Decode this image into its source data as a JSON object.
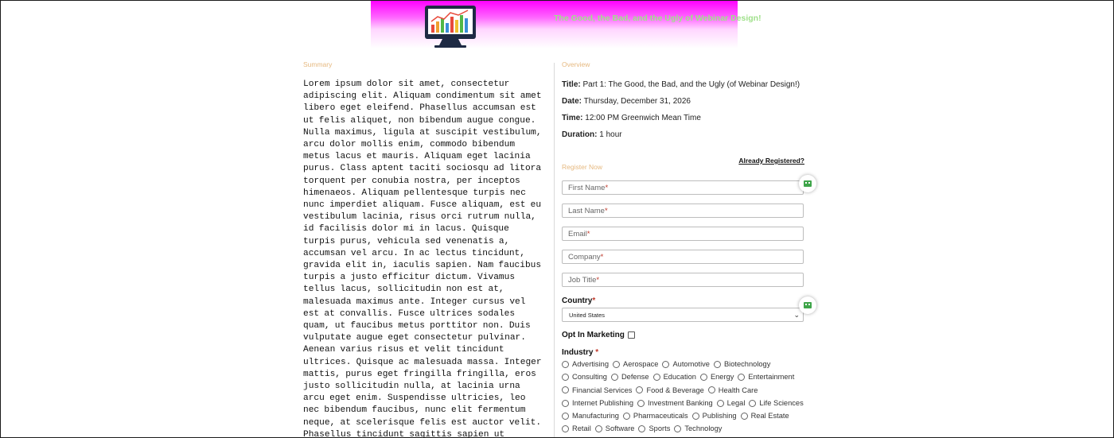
{
  "header": {
    "title": "The Good, the Bad, and the Ugly of Webinar Design!"
  },
  "summary": {
    "label": "Summary",
    "text": "Lorem ipsum dolor sit amet, consectetur adipiscing elit. Aliquam condimentum sit amet libero eget eleifend. Phasellus accumsan est ut felis aliquet, non bibendum augue congue. Nulla maximus, ligula at suscipit vestibulum, arcu dolor mollis enim, commodo bibendum metus lacus et mauris. Aliquam eget lacinia purus. Class aptent taciti sociosqu ad litora torquent per conubia nostra, per inceptos himenaeos. Aliquam pellentesque turpis nec nunc imperdiet aliquam. Fusce aliquam, est eu vestibulum lacinia, risus orci rutrum nulla, id facilisis dolor mi in lacus. Quisque turpis purus, vehicula sed venenatis a, accumsan vel arcu. In ac lectus tincidunt, gravida elit in, iaculis sapien. Nam faucibus turpis a justo efficitur dictum. Vivamus tellus lacus, sollicitudin non est at, malesuada maximus ante. Integer cursus vel est at convallis. Fusce ultrices sodales quam, ut faucibus metus porttitor non. Duis vulputate augue eget consectetur pulvinar. Aenean varius risus et velit tincidunt ultrices. Quisque ac malesuada massa. Integer mattis, purus eget fringilla fringilla, eros justo sollicitudin nulla, at lacinia urna arcu eget enim. Suspendisse ultricies, leo nec bibendum faucibus, nunc elit fermentum neque, at scelerisque felis est auctor velit. Phasellus tincidunt sagittis sapien ut ultrices. Donec lobortis sagittis ultricies."
  },
  "overview": {
    "label": "Overview",
    "title_label": "Title:",
    "title_value": "Part 1: The Good, the Bad, and the Ugly (of Webinar Design!)",
    "date_label": "Date:",
    "date_value": "Thursday, December 31, 2026",
    "time_label": "Time:",
    "time_value": "12:00 PM Greenwich Mean Time",
    "duration_label": "Duration:",
    "duration_value": "1 hour"
  },
  "register": {
    "label": "Register Now",
    "already_registered": "Already Registered?",
    "required_mark": "*",
    "fields": {
      "first_name": "First Name",
      "last_name": "Last Name",
      "email": "Email",
      "company": "Company",
      "job_title": "Job Title"
    },
    "country_label": "Country",
    "country_value": "United States",
    "opt_in_label": "Opt In Marketing",
    "industry_label": "Industry",
    "industries": [
      "Advertising",
      "Aerospace",
      "Automotive",
      "Biotechnology",
      "Consulting",
      "Defense",
      "Education",
      "Energy",
      "Entertainment",
      "Financial Services",
      "Food & Beverage",
      "Health Care",
      "Internet Publishing",
      "Investment Banking",
      "Legal",
      "Life Sciences",
      "Manufacturing",
      "Pharmaceuticals",
      "Publishing",
      "Real Estate",
      "Retail",
      "Software",
      "Sports",
      "Technology"
    ]
  },
  "icons": {
    "logo": "monitor-chart-logo-icon",
    "helper": "form-helper-icon",
    "select_chevron": "chevron-down-icon"
  },
  "colors": {
    "banner_top": "#ff00ff",
    "banner_title": "#9fe08a",
    "section_label": "#e6b980",
    "required": "#c0392b",
    "helper_icon": "#3fa54a"
  }
}
